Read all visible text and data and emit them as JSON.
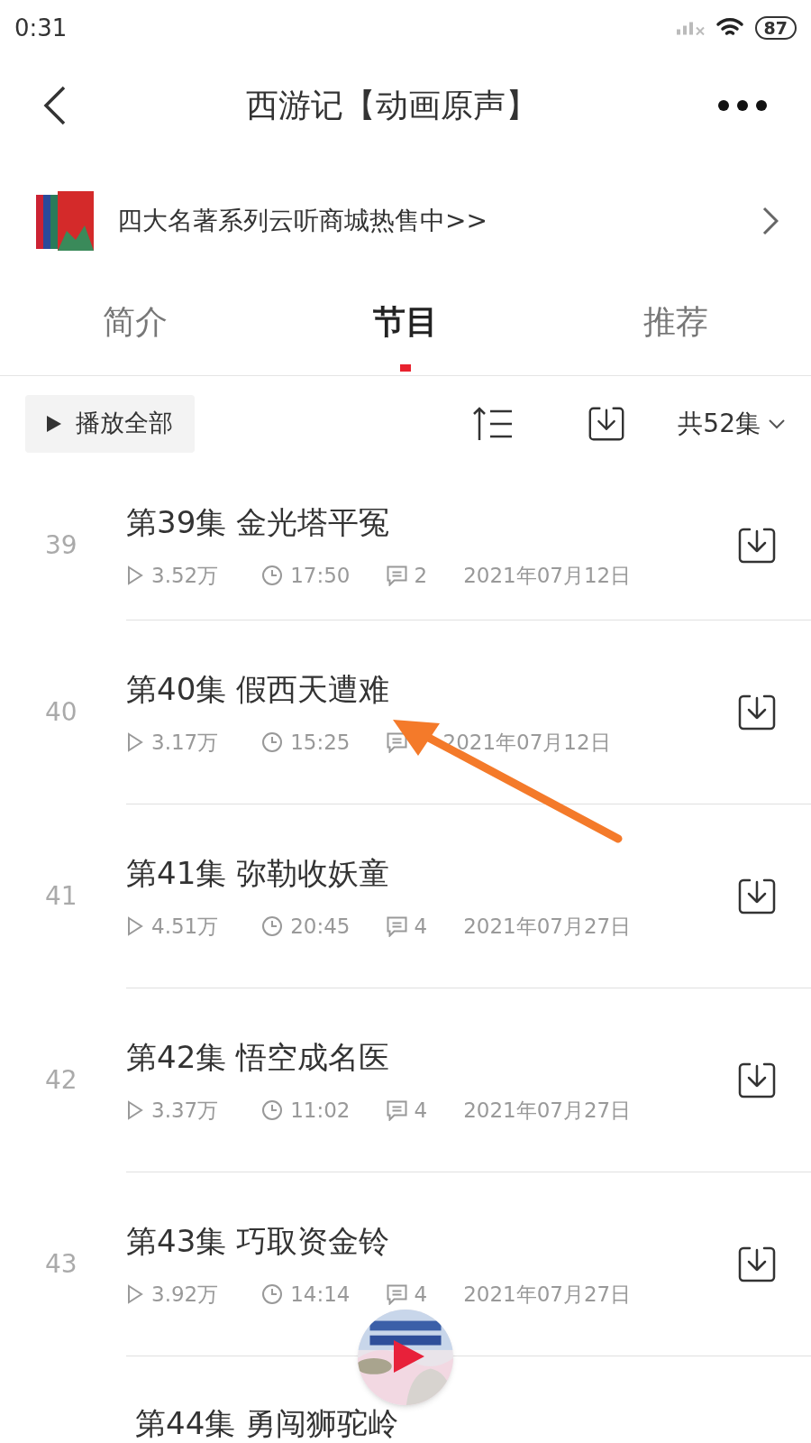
{
  "status_bar": {
    "time": "0:31",
    "battery": "87"
  },
  "header": {
    "title": "西游记【动画原声】"
  },
  "banner": {
    "text": "四大名著系列云听商城热售中>>"
  },
  "tabs": [
    {
      "label": "简介",
      "selected": false
    },
    {
      "label": "节目",
      "selected": true
    },
    {
      "label": "推荐",
      "selected": false
    }
  ],
  "toolbar": {
    "play_all": "播放全部",
    "count": "共52集"
  },
  "episodes": [
    {
      "index": "39",
      "title": "第39集 金光塔平冤",
      "plays": "3.52万",
      "duration": "17:50",
      "comments": "2",
      "date": "2021年07月12日"
    },
    {
      "index": "40",
      "title": "第40集 假西天遭难",
      "plays": "3.17万",
      "duration": "15:25",
      "date": "2021年07月12日"
    },
    {
      "index": "41",
      "title": "第41集 弥勒收妖童",
      "plays": "4.51万",
      "duration": "20:45",
      "comments": "4",
      "date": "2021年07月27日"
    },
    {
      "index": "42",
      "title": "第42集 悟空成名医",
      "plays": "3.37万",
      "duration": "11:02",
      "comments": "4",
      "date": "2021年07月27日"
    },
    {
      "index": "43",
      "title": "第43集 巧取资金铃",
      "plays": "3.92万",
      "duration": "14:14",
      "comments": "4",
      "date": "2021年07月27日"
    },
    {
      "title": "第44集 勇闯狮驼岭"
    }
  ]
}
